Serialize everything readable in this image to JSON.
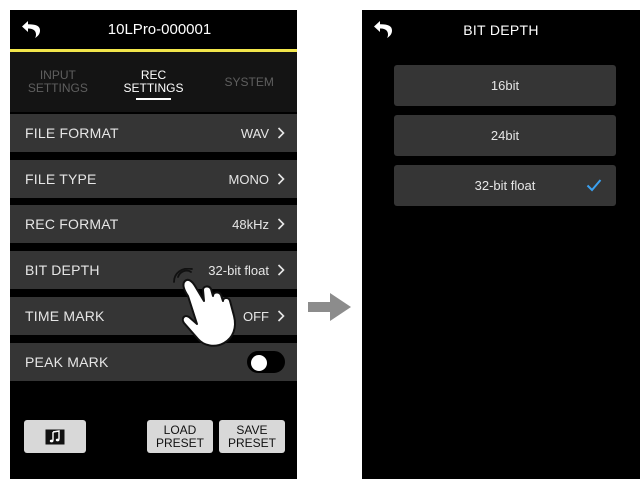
{
  "left": {
    "title": "10LPro-000001",
    "tabs": [
      {
        "label": "INPUT\nSETTINGS",
        "active": false
      },
      {
        "label": "REC\nSETTINGS",
        "active": true
      },
      {
        "label": "SYSTEM",
        "active": false
      }
    ],
    "rows": [
      {
        "label": "FILE FORMAT",
        "value": "WAV"
      },
      {
        "label": "FILE TYPE",
        "value": "MONO"
      },
      {
        "label": "REC FORMAT",
        "value": "48kHz"
      },
      {
        "label": "BIT DEPTH",
        "value": "32-bit float"
      },
      {
        "label": "TIME MARK",
        "value": "OFF"
      },
      {
        "label": "PEAK MARK",
        "value": ""
      }
    ],
    "peak_mark_on": false,
    "buttons": {
      "music_icon": "music-note-icon",
      "load": "LOAD\nPRESET",
      "save": "SAVE\nPRESET"
    }
  },
  "right": {
    "title": "BIT DEPTH",
    "options": [
      {
        "label": "16bit",
        "selected": false
      },
      {
        "label": "24bit",
        "selected": false
      },
      {
        "label": "32-bit float",
        "selected": true
      }
    ]
  },
  "colors": {
    "accent_line": "#f2e64b",
    "check": "#3aa0f0",
    "row_bg": "#353535"
  },
  "icons": [
    "back-arrow-icon",
    "chevron-right-icon",
    "check-icon",
    "music-note-icon",
    "pointing-hand-icon",
    "right-arrow-icon"
  ]
}
